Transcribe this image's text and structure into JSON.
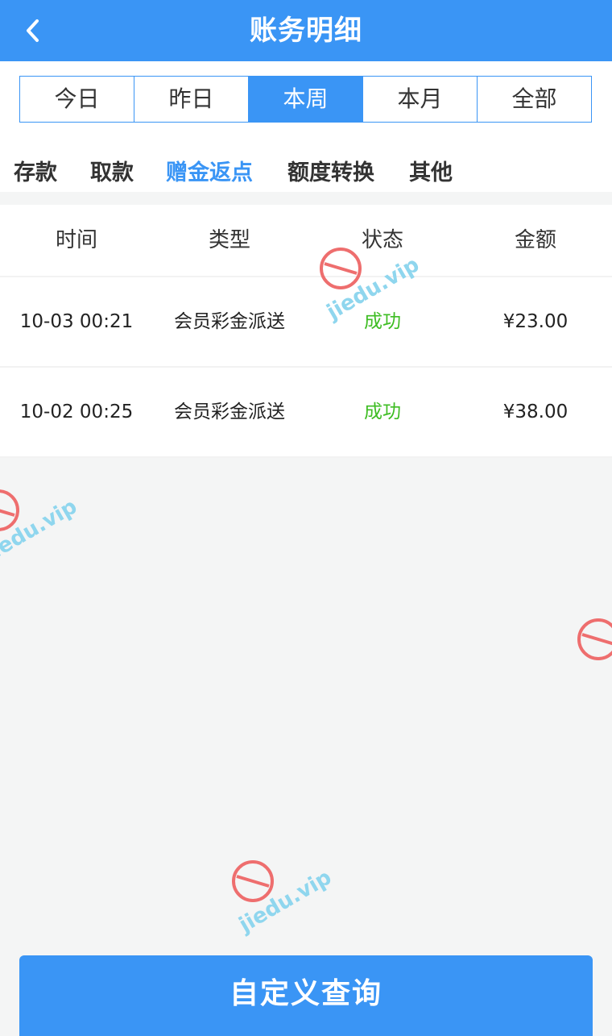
{
  "header": {
    "title": "账务明细",
    "back_icon": "chevron-left-icon"
  },
  "period_tabs": [
    {
      "label": "今日",
      "active": false
    },
    {
      "label": "昨日",
      "active": false
    },
    {
      "label": "本周",
      "active": true
    },
    {
      "label": "本月",
      "active": false
    },
    {
      "label": "全部",
      "active": false
    }
  ],
  "category_tabs": [
    {
      "label": "存款",
      "active": false
    },
    {
      "label": "取款",
      "active": false
    },
    {
      "label": "赠金返点",
      "active": true
    },
    {
      "label": "额度转换",
      "active": false
    },
    {
      "label": "其他",
      "active": false
    }
  ],
  "table": {
    "columns": [
      "时间",
      "类型",
      "状态",
      "金额"
    ],
    "rows": [
      {
        "time": "10-03 00:21",
        "type": "会员彩金派送",
        "status": "成功",
        "amount": "¥23.00"
      },
      {
        "time": "10-02 00:25",
        "type": "会员彩金派送",
        "status": "成功",
        "amount": "¥38.00"
      }
    ]
  },
  "footer": {
    "query_button": "自定义查询"
  },
  "watermark": {
    "text": "jiedu.vip",
    "icon": "no-entry-icon"
  },
  "colors": {
    "accent": "#3a95f5",
    "success": "#3ebd23",
    "background": "#f4f5f5"
  }
}
